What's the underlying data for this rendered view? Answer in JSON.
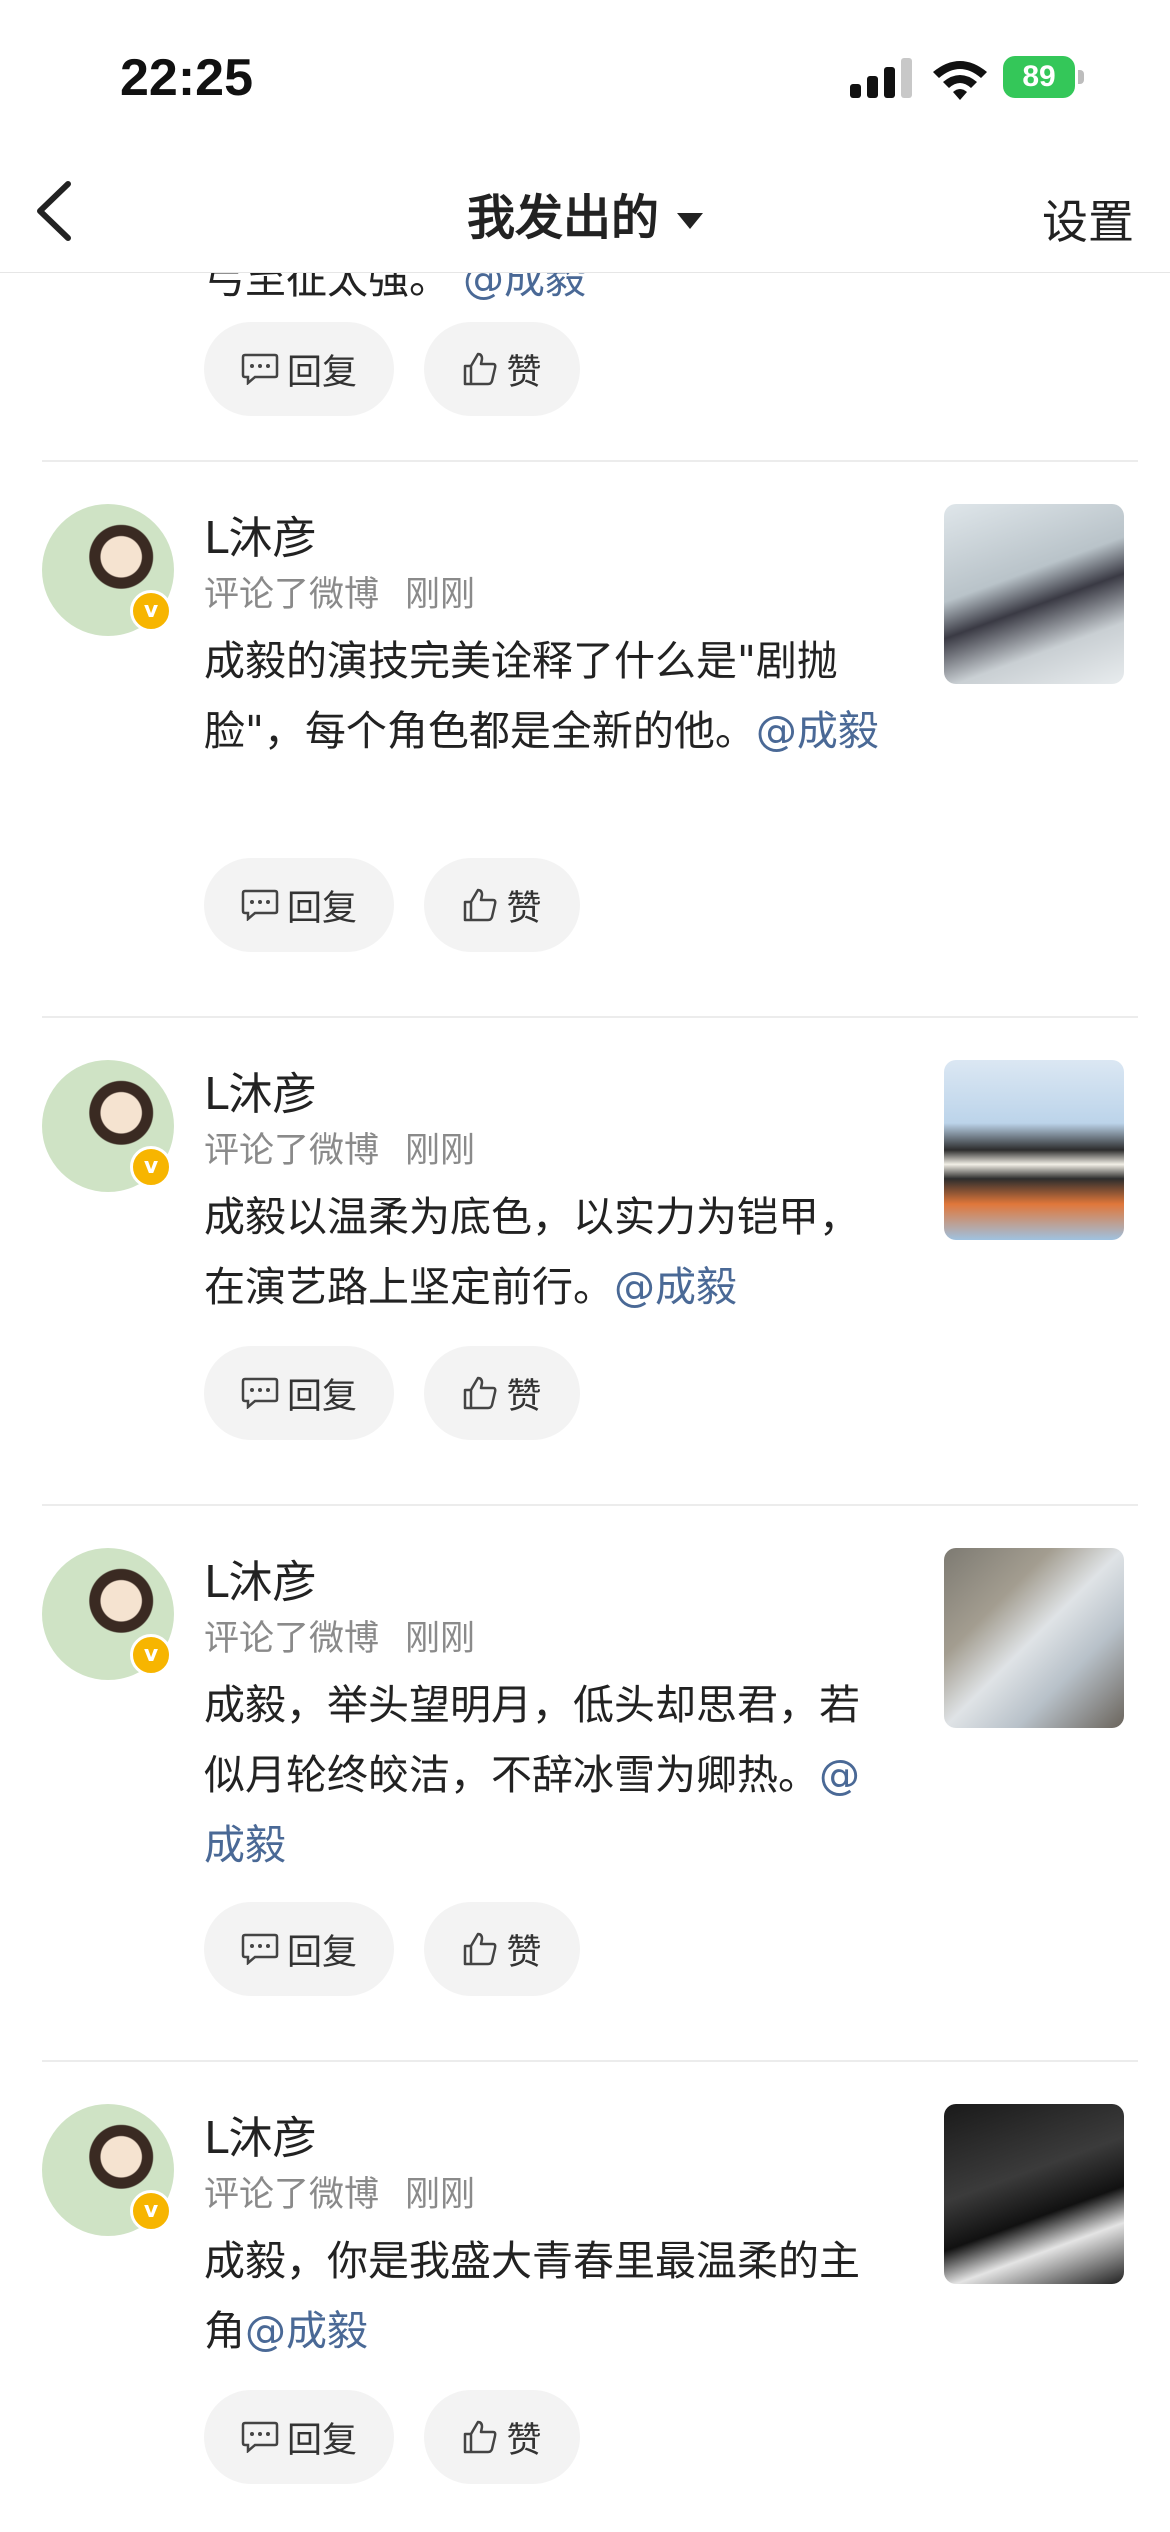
{
  "status_bar": {
    "time": "22:25",
    "battery": "89"
  },
  "header": {
    "title": "我发出的",
    "settings_label": "设置"
  },
  "top_partial": {
    "text": "弓至征太强。",
    "mention": "@成毅",
    "reply_label": "回复",
    "like_label": "赞"
  },
  "posts": [
    {
      "username": "L沐彦",
      "action": "评论了微博",
      "time": "刚刚",
      "text": "成毅的演技完美诠释了什么是\"剧抛脸\"，每个角色都是全新的他。",
      "mention": "@成毅",
      "reply_label": "回复",
      "like_label": "赞"
    },
    {
      "username": "L沐彦",
      "action": "评论了微博",
      "time": "刚刚",
      "text": "成毅以温柔为底色，以实力为铠甲，在演艺路上坚定前行。",
      "mention": "@成毅",
      "reply_label": "回复",
      "like_label": "赞"
    },
    {
      "username": "L沐彦",
      "action": "评论了微博",
      "time": "刚刚",
      "text": "成毅，举头望明月，低头却思君，若似月轮终皎洁，不辞冰雪为卿热。",
      "mention": "@成毅",
      "reply_label": "回复",
      "like_label": "赞"
    },
    {
      "username": "L沐彦",
      "action": "评论了微博",
      "time": "刚刚",
      "text": "成毅，你是我盛大青春里最温柔的主角",
      "mention": "@成毅",
      "reply_label": "回复",
      "like_label": "赞"
    }
  ],
  "colors": {
    "mention": "#4a6996",
    "badge": "#f7b500",
    "battery": "#34c759"
  }
}
